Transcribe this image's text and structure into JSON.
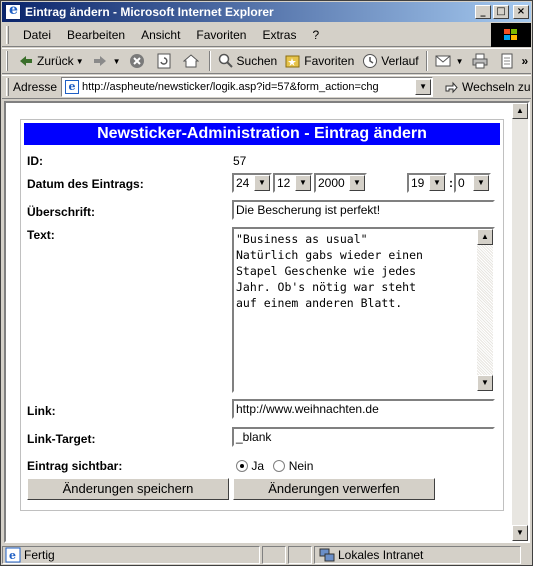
{
  "window": {
    "title": "Eintrag ändern - Microsoft Internet Explorer"
  },
  "menu": [
    "Datei",
    "Bearbeiten",
    "Ansicht",
    "Favoriten",
    "Extras",
    "?"
  ],
  "toolbar": {
    "back": "Zurück",
    "search": "Suchen",
    "favorites": "Favoriten",
    "history": "Verlauf"
  },
  "address": {
    "label": "Adresse",
    "url": "http://aspheute/newsticker/logik.asp?id=57&form_action=chg",
    "go": "Wechseln zu"
  },
  "form": {
    "heading": "Newsticker-Administration - Eintrag ändern",
    "id_label": "ID:",
    "id_value": "57",
    "date_label": "Datum des Eintrags:",
    "day": "24",
    "month": "12",
    "year": "2000",
    "hour": "19",
    "time_sep": ":",
    "minute": "0",
    "headline_label": "Überschrift:",
    "headline_value": "Die Bescherung ist perfekt!",
    "text_label": "Text:",
    "text_value": "\"Business as usual\"\nNatürlich gabs wieder einen\nStapel Geschenke wie jedes\nJahr. Ob's nötig war steht\nauf einem anderen Blatt.",
    "link_label": "Link:",
    "link_value": "http://www.weihnachten.de",
    "target_label": "Link-Target:",
    "target_value": "_blank",
    "visible_label": "Eintrag sichtbar:",
    "visible_yes": "Ja",
    "visible_no": "Nein",
    "visible_selected": "Ja",
    "save_button": "Änderungen speichern",
    "discard_button": "Änderungen verwerfen"
  },
  "status": {
    "text": "Fertig",
    "zone": "Lokales Intranet"
  },
  "colors": {
    "titlebar_start": "#0a246a",
    "titlebar_end": "#a6caf0",
    "form_header_bg": "#0000ff",
    "chrome": "#d4d0c8"
  }
}
